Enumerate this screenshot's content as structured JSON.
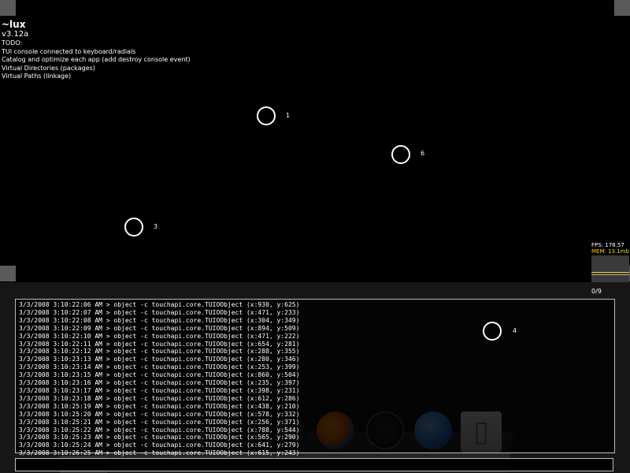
{
  "app": {
    "title": "~lux",
    "version": "v3.12a"
  },
  "todo": {
    "heading": "TODO:",
    "items": [
      "TUI console connected to keyboard/radials",
      "Catalog and optimize each app (add destroy console event)",
      "Virtual Directories (packages)",
      "Virtual Paths (linkage)"
    ]
  },
  "touch_points": [
    {
      "id": "1"
    },
    {
      "id": "6"
    },
    {
      "id": "3"
    },
    {
      "id": "4"
    }
  ],
  "perf": {
    "fps": "FPS: 178.57",
    "mem": "MEM: 13.1mb"
  },
  "colors": {
    "background": "#000000",
    "panel": "#171717",
    "mem_text": "#ffd800",
    "border": "#bcbcbc"
  },
  "page_counter": "0/9",
  "console": {
    "lines": [
      "3/3/2008 3:10:22:06 AM > object -c touchapi.core.TUIOObject (x:930, y:625)",
      "3/3/2008 3:10:22:07 AM > object -c touchapi.core.TUIOObject (x:471, y:233)",
      "3/3/2008 3:10:22:08 AM > object -c touchapi.core.TUIOObject (x:304, y:349)",
      "3/3/2008 3:10:22:09 AM > object -c touchapi.core.TUIOObject (x:894, y:509)",
      "3/3/2008 3:10:22:10 AM > object -c touchapi.core.TUIOObject (x:471, y:222)",
      "3/3/2008 3:10:22:11 AM > object -c touchapi.core.TUIOObject (x:654, y:281)",
      "3/3/2008 3:10:22:12 AM > object -c touchapi.core.TUIOObject (x:288, y:355)",
      "3/3/2008 3:10:23:13 AM > object -c touchapi.core.TUIOObject (x:280, y:346)",
      "3/3/2008 3:10:23:14 AM > object -c touchapi.core.TUIOObject (x:253, y:399)",
      "3/3/2008 3:10:23:15 AM > object -c touchapi.core.TUIOObject (x:860, y:504)",
      "3/3/2008 3:10:23:16 AM > object -c touchapi.core.TUIOObject (x:235, y:397)",
      "3/3/2008 3:10:23:17 AM > object -c touchapi.core.TUIOObject (x:398, y:231)",
      "3/3/2008 3:10:23:18 AM > object -c touchapi.core.TUIOObject (x:612, y:286)",
      "3/3/2008 3:10:25:19 AM > object -c touchapi.core.TUIOObject (x:438, y:210)",
      "3/3/2008 3:10:25:20 AM > object -c touchapi.core.TUIOObject (x:578, y:332)",
      "3/3/2008 3:10:25:21 AM > object -c touchapi.core.TUIOObject (x:256, y:371)",
      "3/3/2008 3:10:25:22 AM > object -c touchapi.core.TUIOObject (x:788, y:544)",
      "3/3/2008 3:10:25:23 AM > object -c touchapi.core.TUIOObject (x:565, y:290)",
      "3/3/2008 3:10:25:24 AM > object -c touchapi.core.TUIOObject (x:641, y:279)",
      "3/3/2008 3:10:26:25 AM > object -c touchapi.core.TUIOObject (x:615, y:243)"
    ]
  },
  "command_input": {
    "value": "",
    "placeholder": ""
  },
  "dock": {
    "icons": [
      "dark-app-icon",
      "firefox-icon",
      "clock-icon",
      "search-icon",
      "finder-icon"
    ],
    "finder_glyph": "▯"
  }
}
